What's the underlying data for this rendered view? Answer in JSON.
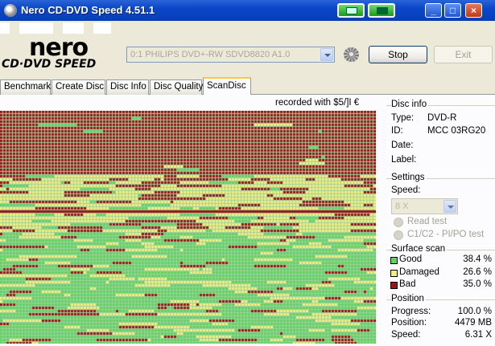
{
  "window": {
    "title": "Nero CD-DVD Speed 4.51.1"
  },
  "logo": {
    "brand": "nero",
    "product": "CD·DVD SPEED"
  },
  "drive": {
    "selected": "0:1  PHILIPS DVD+-RW SDVD8820 A1.0"
  },
  "buttons": {
    "stop": "Stop",
    "exit": "Exit"
  },
  "tabs": [
    {
      "label": "Benchmark"
    },
    {
      "label": "Create Disc"
    },
    {
      "label": "Disc Info"
    },
    {
      "label": "Disc Quality"
    },
    {
      "label": "ScanDisc"
    }
  ],
  "active_tab": "ScanDisc",
  "recorded": "recorded with $5/]I €",
  "disc_info": {
    "title": "Disc info",
    "type_label": "Type:",
    "type_value": "DVD-R",
    "id_label": "ID:",
    "id_value": "MCC 03RG20",
    "date_label": "Date:",
    "label_label": "Label:"
  },
  "settings": {
    "title": "Settings",
    "speed_label": "Speed:",
    "speed_value": "8 X",
    "read_test": "Read test",
    "c1c2": "C1/C2 - PI/PO test"
  },
  "surface_scan": {
    "title": "Surface scan",
    "good_label": "Good",
    "good_value": "38.4 %",
    "damaged_label": "Damaged",
    "damaged_value": "26.6 %",
    "bad_label": "Bad",
    "bad_value": "35.0 %",
    "colors": {
      "good": "#5fd35f",
      "damaged": "#f3ef7a",
      "bad": "#9e1313"
    }
  },
  "position": {
    "title": "Position",
    "progress_label": "Progress:",
    "progress_value": "100.0 %",
    "position_label": "Position:",
    "position_value": "4479 MB",
    "speed_label": "Speed:",
    "speed_value": "6.31 X"
  }
}
